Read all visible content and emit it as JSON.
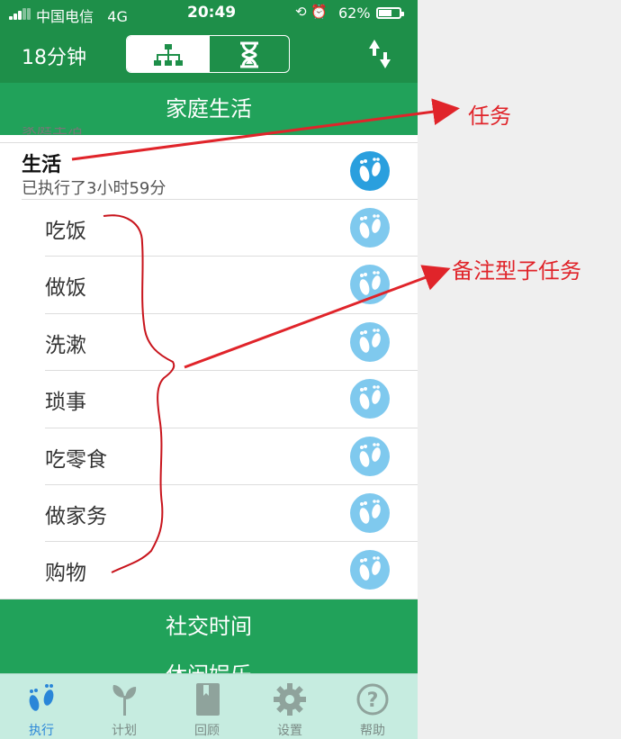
{
  "status_bar": {
    "carrier": "中国电信",
    "network": "4G",
    "time": "20:49",
    "battery_level": 0.62,
    "battery_text": "62%"
  },
  "nav": {
    "elapsed": "18分钟"
  },
  "sections": {
    "current": "家庭生活",
    "next": "社交时间",
    "next2": "休闲娱乐"
  },
  "task": {
    "name": "生活",
    "executed": "已执行了3小时59分",
    "partial_above": "家庭生活"
  },
  "subtasks": [
    "吃饭",
    "做饭",
    "洗漱",
    "琐事",
    "吃零食",
    "做家务",
    "购物"
  ],
  "tabbar": {
    "items": [
      "执行",
      "计划",
      "回顾",
      "设置",
      "帮助"
    ],
    "active": "执行"
  },
  "annotations": {
    "task_label": "任务",
    "subtask_label": "备注型子任务"
  },
  "colors": {
    "nav_green": "#1e8f49",
    "section_green": "#21a25a",
    "tabbar": "#c6ece0",
    "active_blue": "#2a86d8",
    "annotation_red": "#e0242a"
  }
}
